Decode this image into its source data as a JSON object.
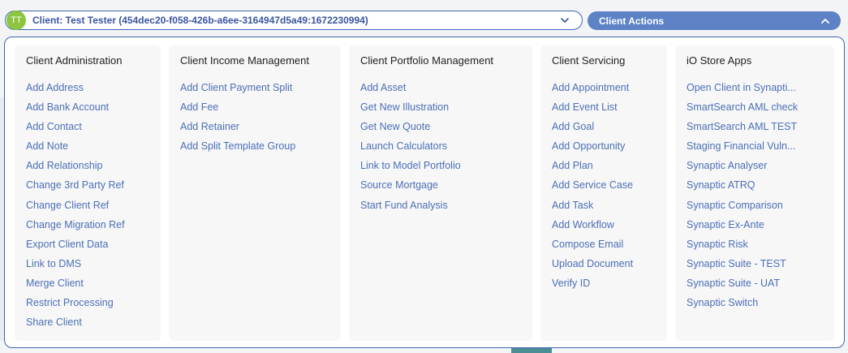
{
  "client": {
    "avatar_initials": "TT",
    "label": "Client: Test Tester (454dec20-f058-426b-a6ee-3164947d5a49:1672230994)"
  },
  "actions_button": {
    "label": "Client Actions"
  },
  "colors": {
    "accent": "#5d83c6",
    "link": "#4b6fb5",
    "border": "#3f63b4",
    "avatar": "#8cc63f"
  },
  "columns": [
    {
      "title": "Client Administration",
      "items": [
        "Add Address",
        "Add Bank Account",
        "Add Contact",
        "Add Note",
        "Add Relationship",
        "Change 3rd Party Ref",
        "Change Client Ref",
        "Change Migration Ref",
        "Export Client Data",
        "Link to DMS",
        "Merge Client",
        "Restrict Processing",
        "Share Client"
      ]
    },
    {
      "title": "Client Income Management",
      "items": [
        "Add Client Payment Split",
        "Add Fee",
        "Add Retainer",
        "Add Split Template Group"
      ]
    },
    {
      "title": "Client Portfolio Management",
      "items": [
        "Add Asset",
        "Get New Illustration",
        "Get New Quote",
        "Launch Calculators",
        "Link to Model Portfolio",
        "Source Mortgage",
        "Start Fund Analysis"
      ]
    },
    {
      "title": "Client Servicing",
      "items": [
        "Add Appointment",
        "Add Event List",
        "Add Goal",
        "Add Opportunity",
        "Add Plan",
        "Add Service Case",
        "Add Task",
        "Add Workflow",
        "Compose Email",
        "Upload Document",
        "Verify ID"
      ]
    },
    {
      "title": "iO Store Apps",
      "items": [
        "Open Client in Synapti...",
        "SmartSearch AML check",
        "SmartSearch AML TEST",
        "Staging Financial Vuln...",
        "Synaptic Analyser",
        "Synaptic ATRQ",
        "Synaptic Comparison",
        "Synaptic Ex-Ante",
        "Synaptic Risk",
        "Synaptic Suite - TEST",
        "Synaptic Suite - UAT",
        "Synaptic Switch"
      ]
    }
  ]
}
